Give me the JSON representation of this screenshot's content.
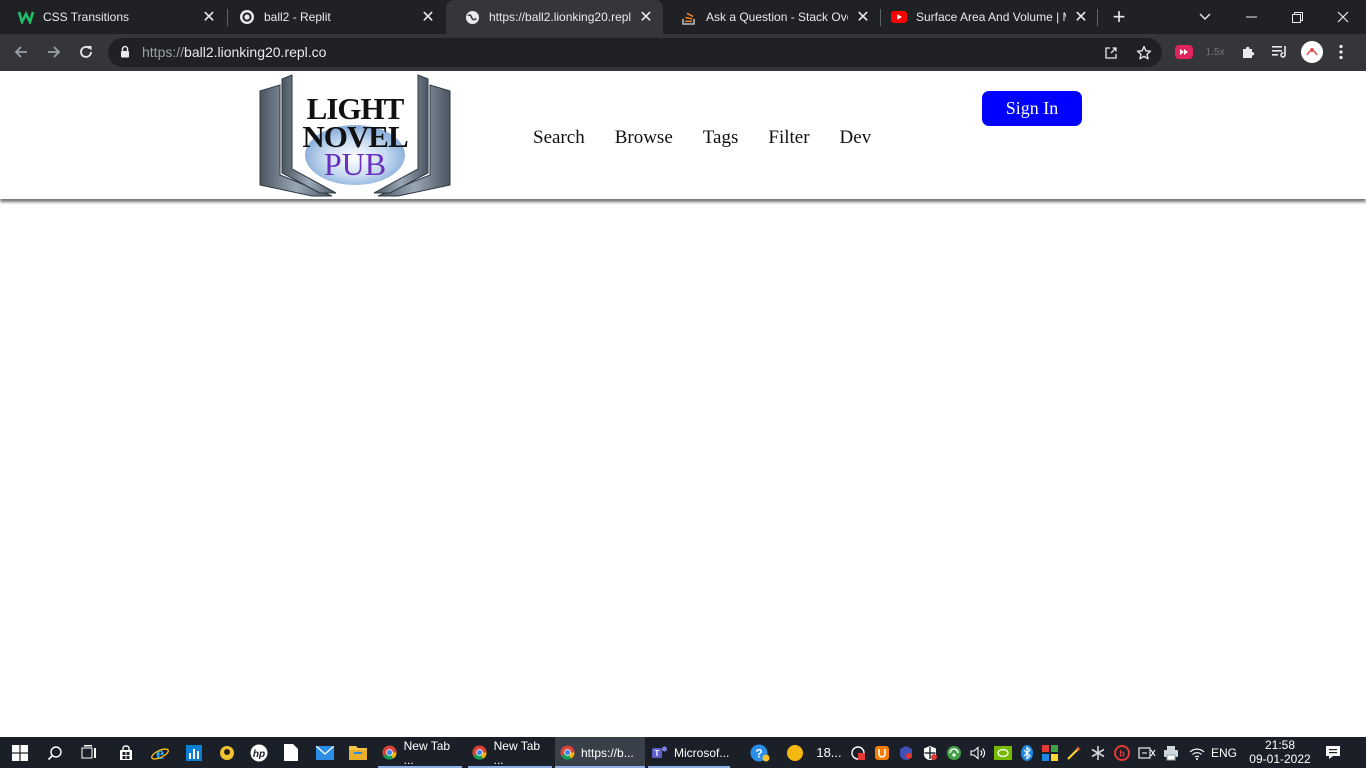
{
  "browser": {
    "tabs": [
      {
        "title": "CSS Transitions",
        "icon": "w-logo-icon"
      },
      {
        "title": "ball2 - Replit",
        "icon": "replit-icon"
      },
      {
        "title": "https://ball2.lionking20.repl.c",
        "icon": "globe-icon"
      },
      {
        "title": "Ask a Question - Stack Overfl",
        "icon": "stackoverflow-icon"
      },
      {
        "title": "Surface Area And Volume | M",
        "icon": "youtube-icon"
      }
    ],
    "url_scheme": "https://",
    "url_host": "ball2.lionking20.repl.co",
    "speed_badge": "1.5x"
  },
  "site": {
    "logo": {
      "line1": "LIGHT",
      "line2": "NOVEL",
      "line3": "PUB"
    },
    "nav": [
      "Search",
      "Browse",
      "Tags",
      "Filter",
      "Dev"
    ],
    "signin_label": "Sign In",
    "colors": {
      "signin_bg": "#0000ff",
      "logo_purple": "#6a2fc0"
    }
  },
  "taskbar": {
    "apps": [
      {
        "label": "New Tab ...",
        "icon": "chrome-icon"
      },
      {
        "label": "New Tab ...",
        "icon": "chrome-icon"
      },
      {
        "label": "https://b...",
        "icon": "chrome-icon"
      },
      {
        "label": "Microsof...",
        "icon": "teams-icon"
      }
    ],
    "weather": "18...",
    "language": "ENG",
    "time": "21:58",
    "date": "09-01-2022"
  }
}
